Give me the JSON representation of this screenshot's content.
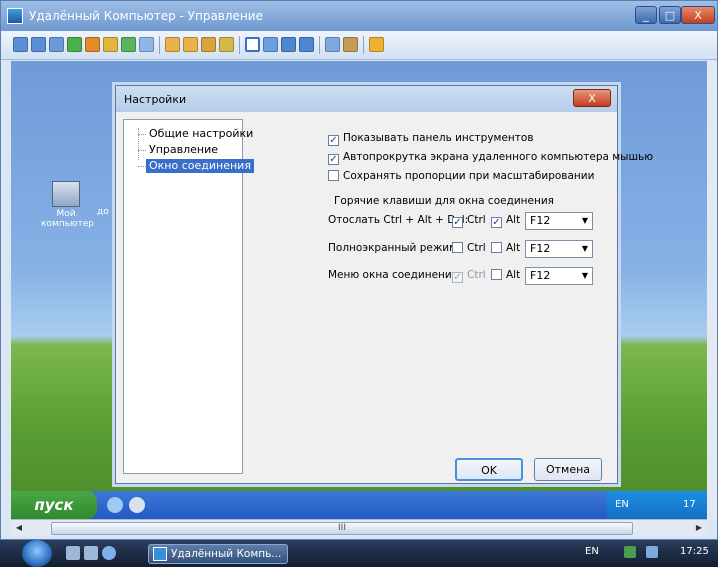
{
  "outer_window": {
    "title": "Удалённый Компьютер - Управление",
    "buttons": [
      "_",
      "□",
      "X"
    ]
  },
  "toolbar": {
    "icons": [
      "monitor-icon",
      "monitor-icon",
      "monitor-icon",
      "refresh-icon",
      "clock-icon",
      "chat-icon",
      "phone-icon",
      "message-icon",
      "user-icon",
      "users-icon",
      "lock-icon",
      "trash-icon",
      "fullscreen-icon",
      "window-icon",
      "window-icon",
      "display-icon",
      "copy-icon",
      "tools-icon",
      "close-icon"
    ]
  },
  "remote_desktop": {
    "icon_label": "Мой компьютер",
    "icon_label2": "до",
    "start_label": "пуск",
    "tray_lang": "EN",
    "tray_time": "17"
  },
  "scroll": {
    "thumb_label": "III"
  },
  "dialog": {
    "title": "Настройки",
    "close_label": "X",
    "tree": [
      {
        "label": "Общие настройки",
        "selected": false
      },
      {
        "label": "Управление",
        "selected": false
      },
      {
        "label": "Окно соединения",
        "selected": true
      }
    ],
    "options": [
      {
        "label": "Показывать панель инструментов",
        "checked": true
      },
      {
        "label": "Автопрокрутка экрана удаленного компьютера мышью",
        "checked": true
      },
      {
        "label": "Сохранять пропорции при масштабировании",
        "checked": false
      }
    ],
    "hotkeys_title": "Горячие клавиши для окна соединения",
    "hotkeys": [
      {
        "label": "Отослать Ctrl + Alt + Del:",
        "ctrl_label": "Ctrl",
        "ctrl": true,
        "alt_label": "Alt",
        "alt": true,
        "key": "F12",
        "ctrl_disabled": false
      },
      {
        "label": "Полноэкранный режим:",
        "ctrl_label": "Ctrl",
        "ctrl": false,
        "alt_label": "Alt",
        "alt": false,
        "key": "F12",
        "ctrl_disabled": false
      },
      {
        "label": "Меню окна соединения:",
        "ctrl_label": "Ctrl",
        "ctrl": true,
        "alt_label": "Alt",
        "alt": false,
        "key": "F12",
        "ctrl_disabled": true
      }
    ],
    "ok_label": "OK",
    "cancel_label": "Отмена"
  },
  "vista_taskbar": {
    "task_label": "Удалённый Компь...",
    "lang": "EN",
    "time": "17:25"
  }
}
